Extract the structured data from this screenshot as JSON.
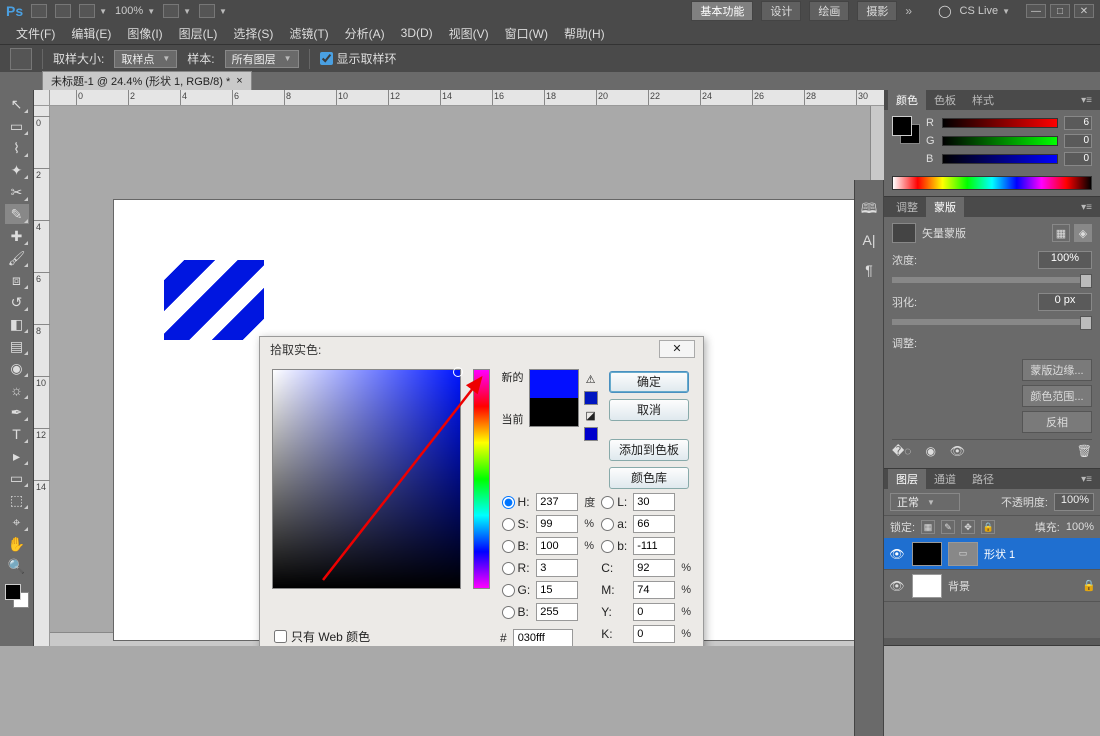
{
  "titlebar": {
    "zoom_menu": "100%",
    "workspace_buttons": [
      "基本功能",
      "设计",
      "绘画",
      "摄影"
    ],
    "cslive": "CS Live"
  },
  "menus": [
    "文件(F)",
    "编辑(E)",
    "图像(I)",
    "图层(L)",
    "选择(S)",
    "滤镜(T)",
    "分析(A)",
    "3D(D)",
    "视图(V)",
    "窗口(W)",
    "帮助(H)"
  ],
  "options": {
    "sample_size_label": "取样大小:",
    "sample_size_value": "取样点",
    "sample_label": "样本:",
    "sample_value": "所有图层",
    "show_ring": "显示取样环"
  },
  "doc_tab": "未标题-1 @ 24.4% (形状 1, RGB/8) *",
  "ruler_h": [
    "0",
    "2",
    "4",
    "6",
    "8",
    "10",
    "12",
    "14",
    "16",
    "18",
    "20",
    "22",
    "24",
    "26",
    "28",
    "30"
  ],
  "ruler_v": [
    "0",
    "2",
    "4",
    "6",
    "8",
    "10",
    "12",
    "14"
  ],
  "color_panel": {
    "tabs": [
      "颜色",
      "色板",
      "样式"
    ],
    "r_label": "R",
    "g_label": "G",
    "b_label": "B",
    "r": "6",
    "g": "0",
    "b": "0"
  },
  "adjust_tab": "调整",
  "mask_panel": {
    "tab": "蒙版",
    "label": "矢量蒙版",
    "density_label": "浓度:",
    "density_value": "100%",
    "feather_label": "羽化:",
    "feather_value": "0 px",
    "refine_label": "调整:",
    "btn_refine_edge": "蒙版边缘...",
    "btn_color_range": "颜色范围...",
    "btn_invert": "反相"
  },
  "layers_panel": {
    "tabs": [
      "图层",
      "通道",
      "路径"
    ],
    "blend_mode": "正常",
    "opacity_label": "不透明度:",
    "opacity_value": "100%",
    "lock_label": "锁定:",
    "fill_label": "填充:",
    "fill_value": "100%",
    "layers": [
      {
        "name": "形状 1",
        "selected": true,
        "thumb": "black",
        "hasVectorMask": true
      },
      {
        "name": "背景",
        "selected": false,
        "thumb": "white",
        "locked": true
      }
    ]
  },
  "picker": {
    "title": "拾取实色:",
    "new_label": "新的",
    "current_label": "当前",
    "btn_ok": "确定",
    "btn_cancel": "取消",
    "btn_add": "添加到色板",
    "btn_lib": "颜色库",
    "H_label": "H:",
    "H": "237",
    "H_unit": "度",
    "S_label": "S:",
    "S": "99",
    "S_unit": "%",
    "Bv_label": "B:",
    "Bv": "100",
    "Bv_unit": "%",
    "R_label": "R:",
    "R": "3",
    "G_label": "G:",
    "G": "15",
    "Bc_label": "B:",
    "Bc": "255",
    "L_label": "L:",
    "L": "30",
    "a_label": "a:",
    "a": "66",
    "b_label": "b:",
    "b": "-111",
    "C_label": "C:",
    "C": "92",
    "pct": "%",
    "M_label": "M:",
    "M": "74",
    "Y_label": "Y:",
    "Y": "0",
    "K_label": "K:",
    "K": "0",
    "hex_label": "#",
    "hex": "030fff",
    "web_only": "只有 Web 颜色"
  }
}
